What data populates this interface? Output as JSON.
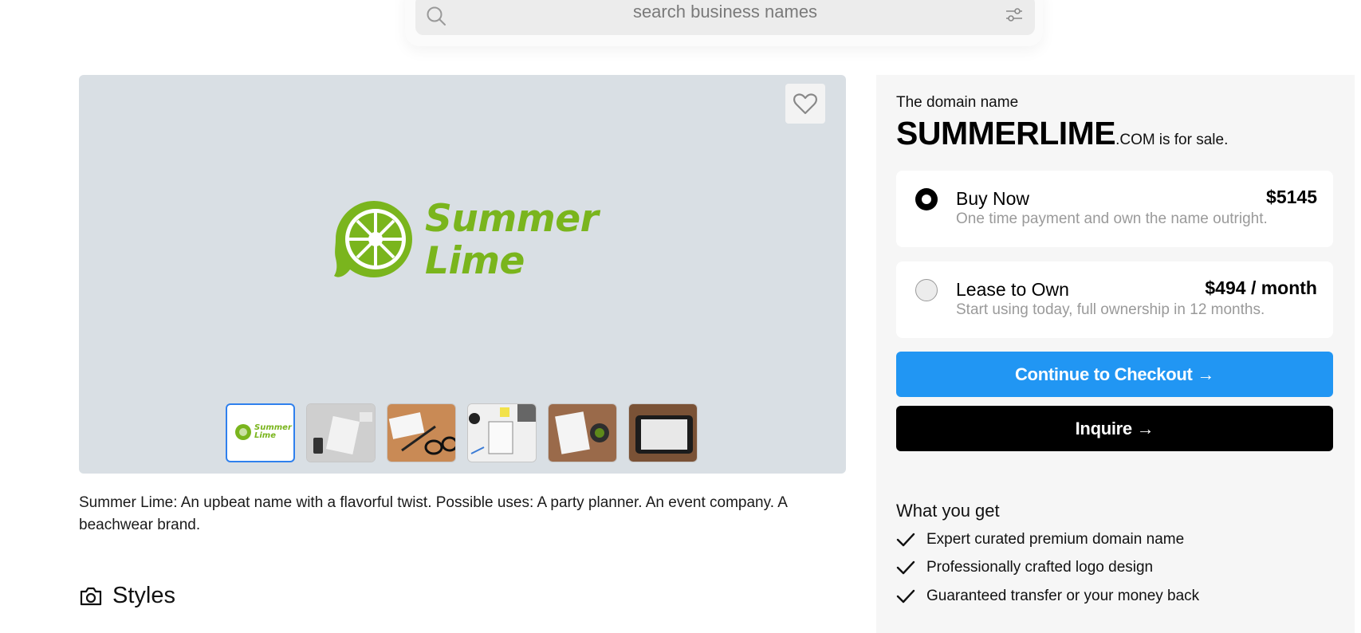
{
  "search": {
    "placeholder": "search business names"
  },
  "hero": {
    "logo_line1": "Summer",
    "logo_line2": "Lime",
    "thumbnails": [
      {
        "name": "logo",
        "logo_line1": "Summer",
        "logo_line2": "Lime"
      },
      {
        "name": "desk-gray"
      },
      {
        "name": "desk-glasses"
      },
      {
        "name": "desk-notebook"
      },
      {
        "name": "desk-coffee"
      },
      {
        "name": "desk-tablet"
      }
    ],
    "colors": {
      "brand_green": "#7ab51d",
      "panel": "#d9dfe4"
    }
  },
  "description": "Summer Lime: An upbeat name with a flavorful twist. Possible uses: A party planner. An event company. A beachwear brand.",
  "styles_heading": "Styles",
  "sale": {
    "label": "The domain name",
    "name": "SUMMERLIME",
    "tld": ".COM",
    "for_sale": "is for sale.",
    "options": [
      {
        "title": "Buy Now",
        "price": "$5145",
        "subtitle": "One time payment and own the name outright.",
        "selected": true
      },
      {
        "title": "Lease to Own",
        "price": "$494 / month",
        "subtitle": "Start using today, full ownership in 12 months.",
        "selected": false
      }
    ],
    "checkout_label": "Continue to Checkout →",
    "inquire_label": "Inquire →",
    "colors": {
      "checkout": "#2196f3",
      "inquire": "#000000"
    }
  },
  "what_you_get": {
    "title": "What you get",
    "items": [
      "Expert curated premium domain name",
      "Professionally crafted logo design",
      "Guaranteed transfer or your money back"
    ]
  }
}
